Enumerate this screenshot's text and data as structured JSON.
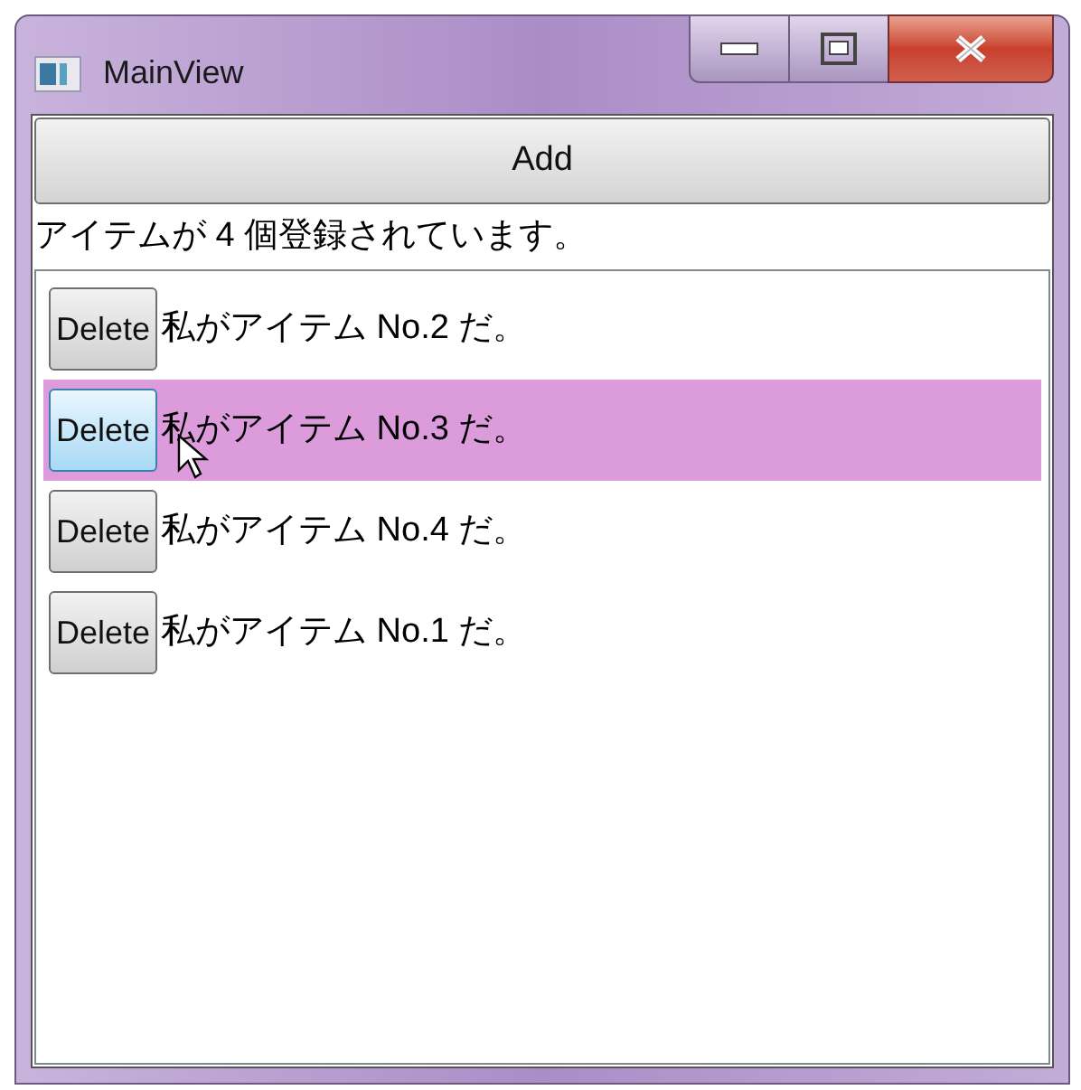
{
  "window": {
    "title": "MainView"
  },
  "add_button": {
    "label": "Add"
  },
  "count_text": "アイテムが 4 個登録されています。",
  "items": [
    {
      "button": "Delete",
      "text": "私がアイテム No.2 だ。",
      "selected": false,
      "hovered": false
    },
    {
      "button": "Delete",
      "text": "私がアイテム No.3 だ。",
      "selected": true,
      "hovered": true
    },
    {
      "button": "Delete",
      "text": "私がアイテム No.4 だ。",
      "selected": false,
      "hovered": false
    },
    {
      "button": "Delete",
      "text": "私がアイテム No.1 だ。",
      "selected": false,
      "hovered": false
    }
  ]
}
